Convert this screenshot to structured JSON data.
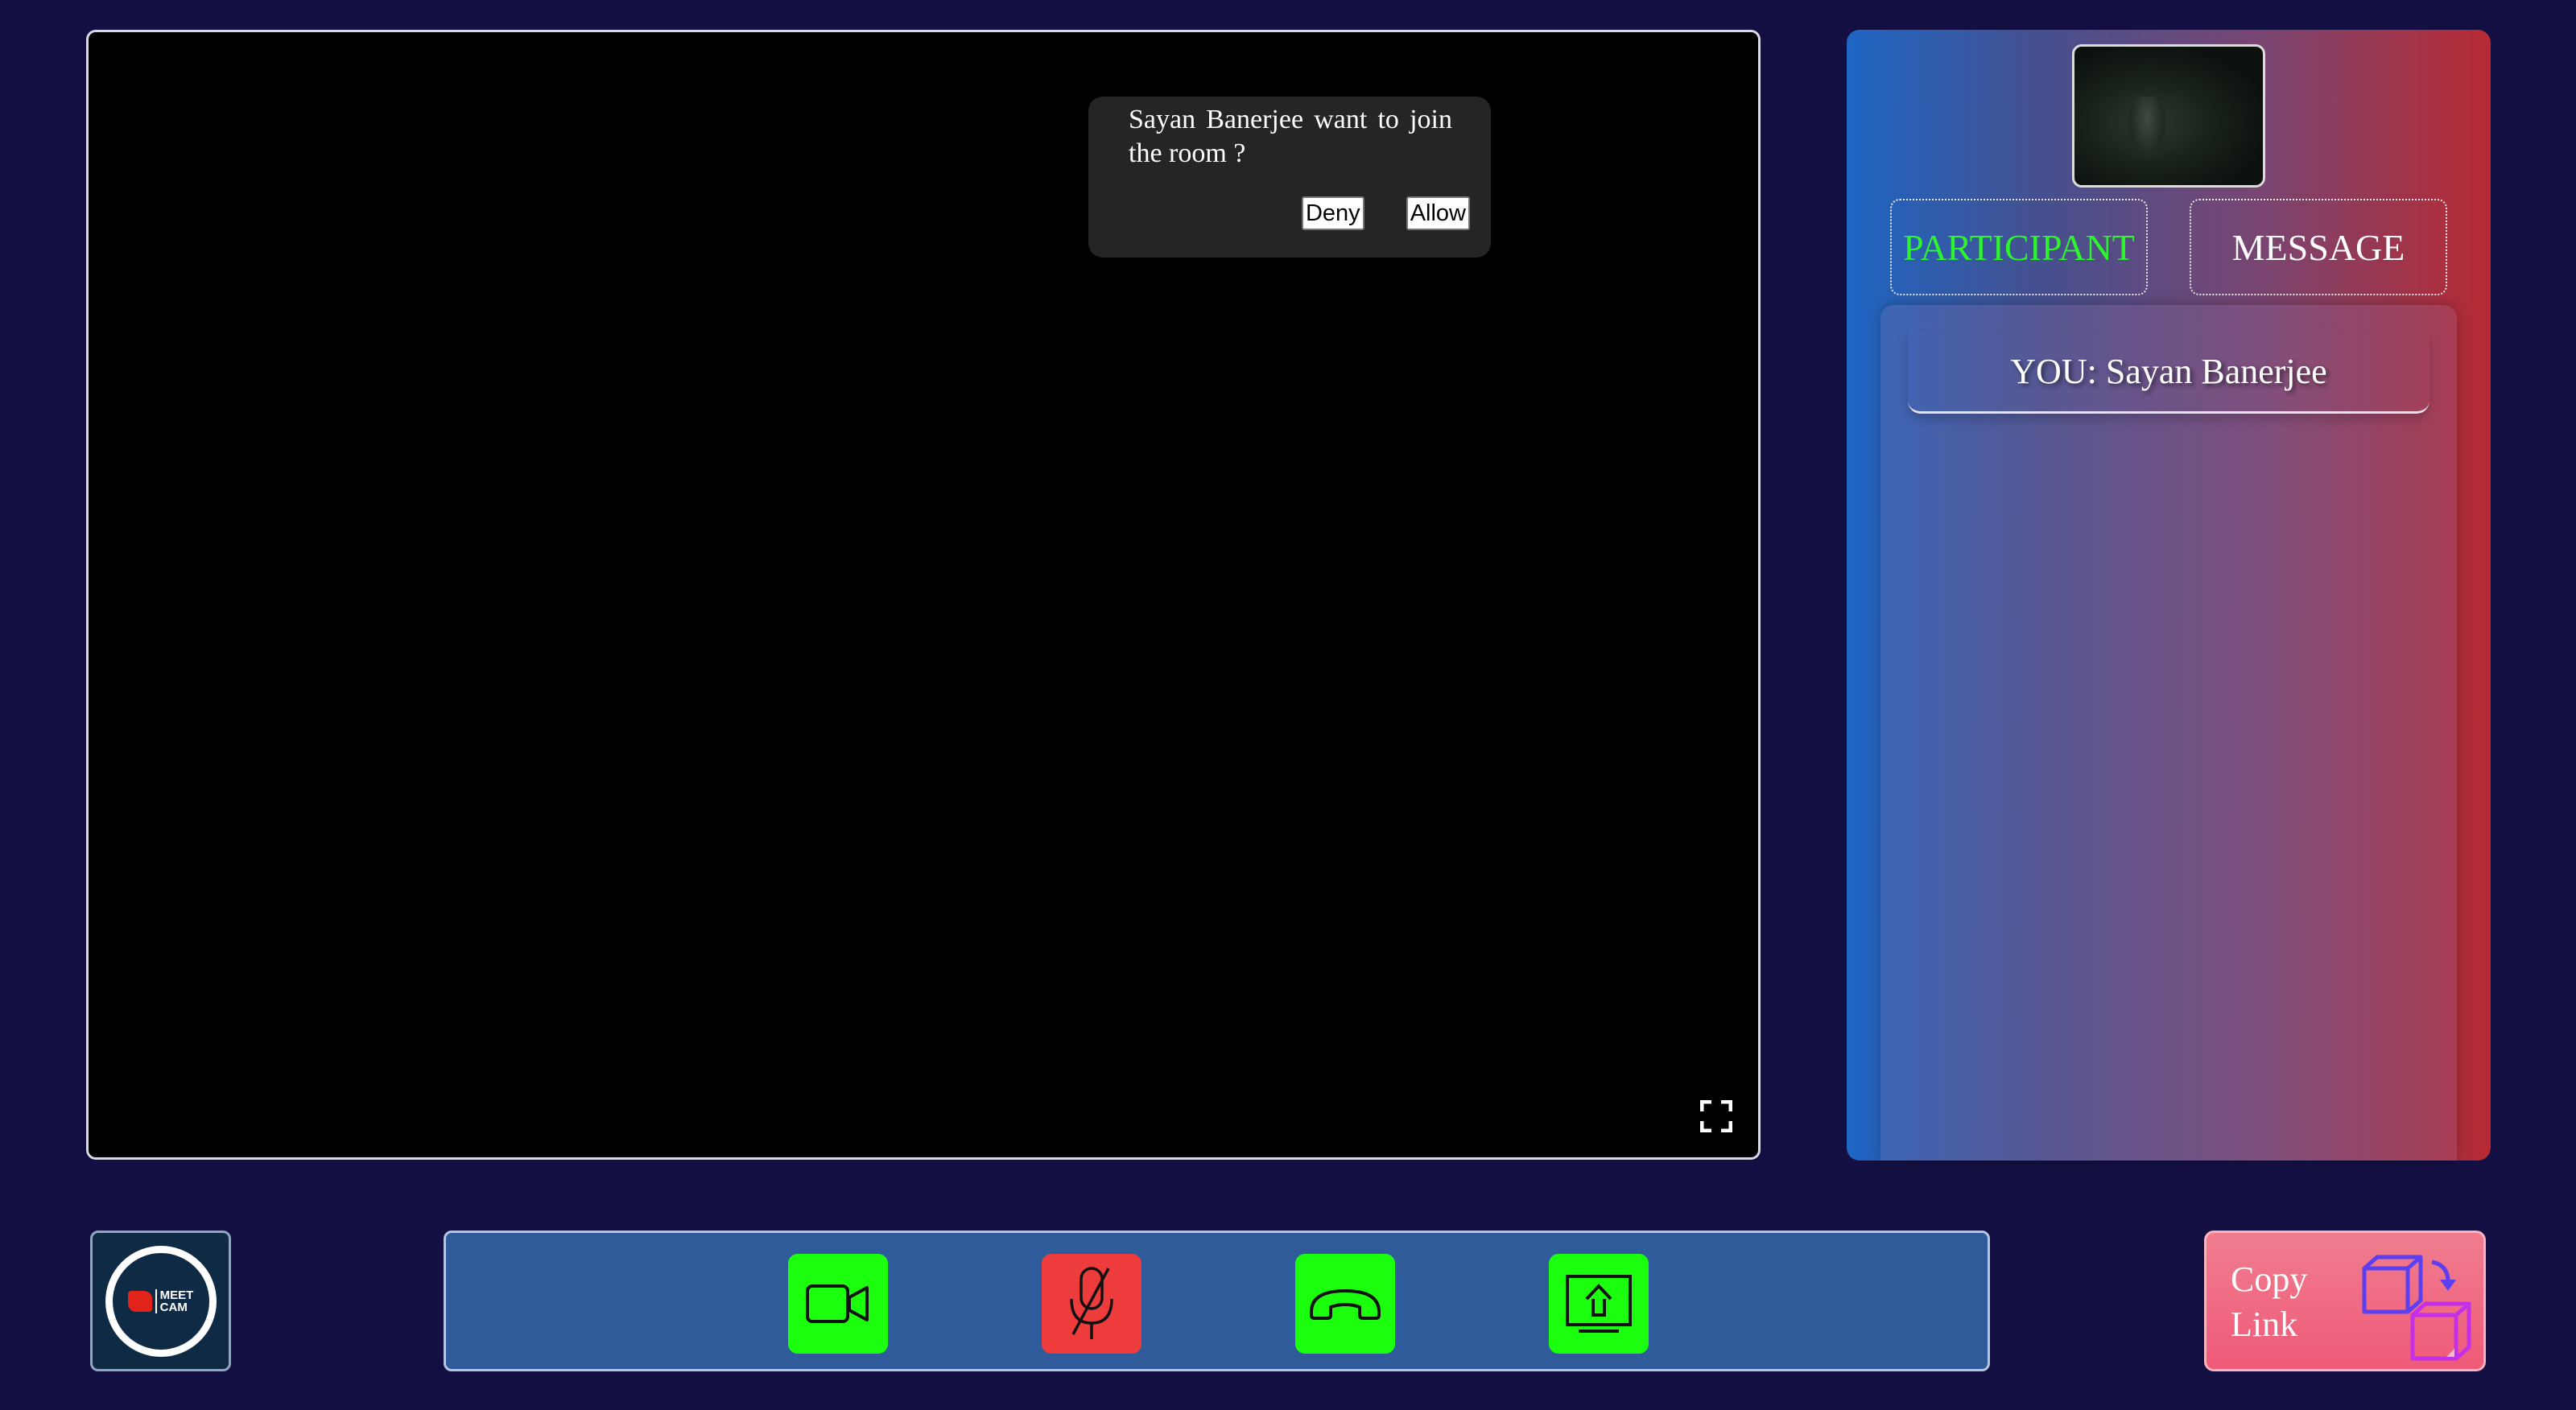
{
  "join_request": {
    "message": "Sayan Banerjee want to join the room ?",
    "deny_label": "Deny",
    "allow_label": "Allow"
  },
  "side_panel": {
    "tabs": {
      "participant": "PARTICIPANT",
      "message": "MESSAGE"
    },
    "active_tab": "participant",
    "participants": [
      {
        "label": "YOU: Sayan Banerjee"
      }
    ]
  },
  "logo": {
    "text_line1": "MEET",
    "text_line2": "CAM"
  },
  "controls": {
    "video_icon": "video-camera-icon",
    "mic_icon": "microphone-muted-icon",
    "end_icon": "phone-hangup-icon",
    "share_icon": "screen-share-icon"
  },
  "copy_link": {
    "line1": "Copy",
    "line2": "Link"
  },
  "colors": {
    "background": "#130f42",
    "control_active": "#1bff0f",
    "control_muted": "#ee3b3b",
    "controls_bar": "#2f5b9a",
    "participant_tab_active": "#2df52d",
    "copy_link_bg": "#ef5a78"
  }
}
